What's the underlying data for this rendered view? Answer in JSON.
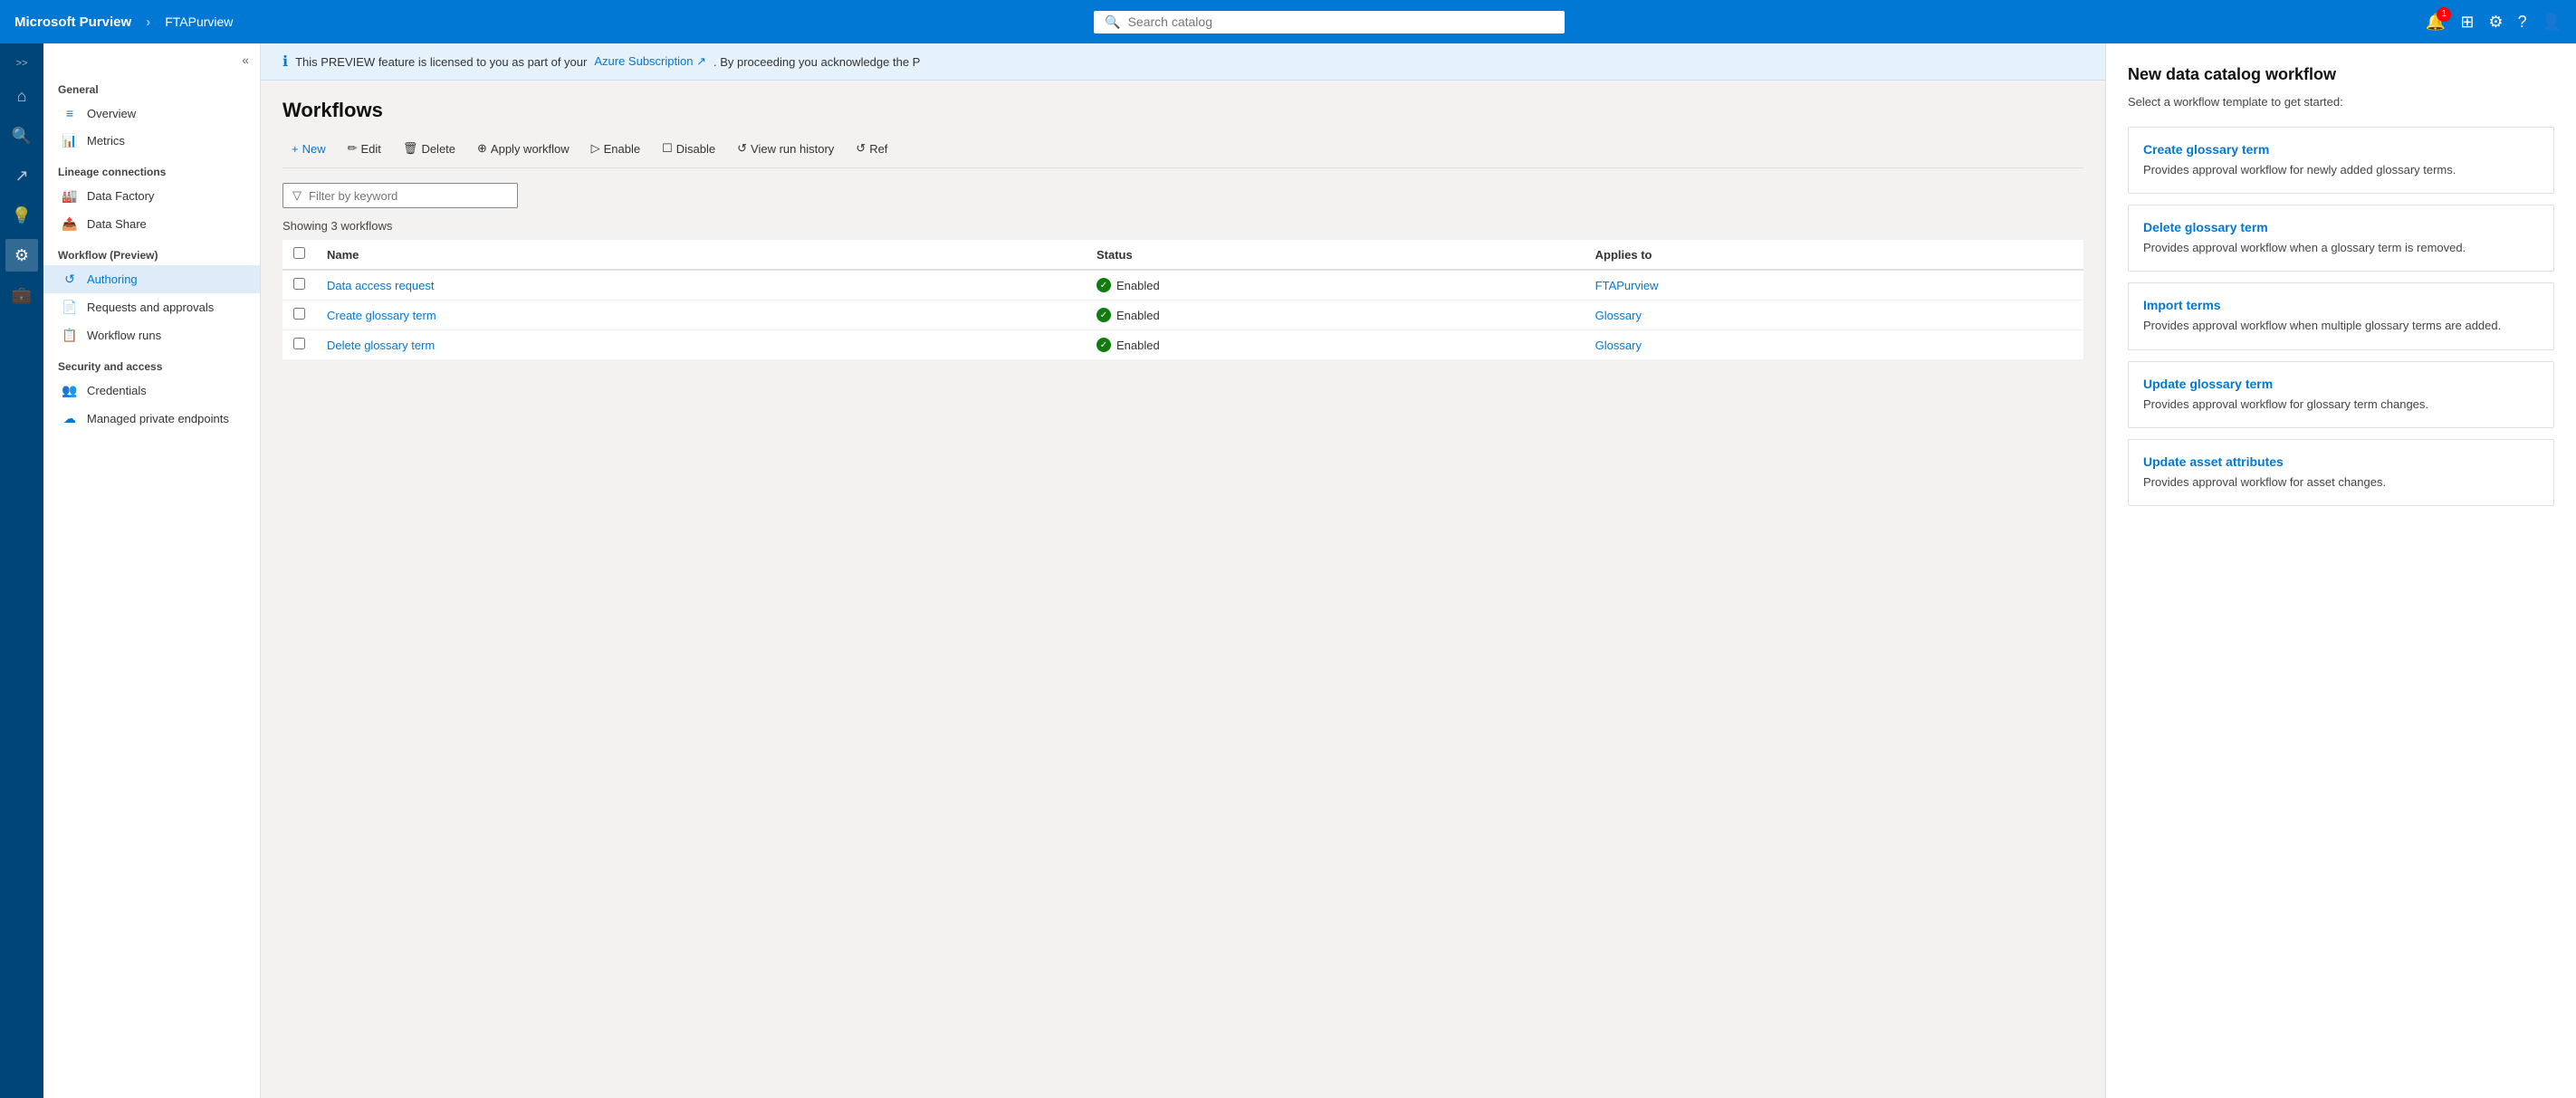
{
  "topNav": {
    "brand": "Microsoft Purview",
    "separator": "›",
    "instance": "FTAPurview",
    "searchPlaceholder": "Search catalog",
    "notificationBadge": "1",
    "icons": {
      "grid": "⊞",
      "bell": "🔔",
      "gear": "⚙",
      "question": "?",
      "user": "👤"
    }
  },
  "leftNav": {
    "collapseBtn": "«",
    "sections": [
      {
        "title": "General",
        "items": [
          {
            "icon": "≡",
            "label": "Overview"
          },
          {
            "icon": "📊",
            "label": "Metrics"
          }
        ]
      },
      {
        "title": "Lineage connections",
        "items": [
          {
            "icon": "🏭",
            "label": "Data Factory"
          },
          {
            "icon": "📤",
            "label": "Data Share"
          }
        ]
      },
      {
        "title": "Workflow (Preview)",
        "items": [
          {
            "icon": "↺",
            "label": "Authoring",
            "active": true
          },
          {
            "icon": "📄",
            "label": "Requests and approvals"
          },
          {
            "icon": "📋",
            "label": "Workflow runs"
          }
        ]
      },
      {
        "title": "Security and access",
        "items": [
          {
            "icon": "👥",
            "label": "Credentials"
          },
          {
            "icon": "☁",
            "label": "Managed private endpoints"
          }
        ]
      }
    ]
  },
  "infoBanner": {
    "text": "This PREVIEW feature is licensed to you as part of your",
    "linkText": "Azure Subscription ↗",
    "textAfter": ". By proceeding you acknowledge the P"
  },
  "page": {
    "title": "Workflows",
    "toolbar": {
      "newLabel": "+ New",
      "editLabel": "✏ Edit",
      "deleteLabel": "🗑 Delete",
      "applyLabel": "⊕ Apply workflow",
      "enableLabel": "▷ Enable",
      "disableLabel": "☐ Disable",
      "viewRunLabel": "↺ View run history",
      "refreshLabel": "↺ Ref"
    },
    "filter": {
      "placeholder": "Filter by keyword",
      "showingCount": "Showing 3 workflows"
    },
    "tableHeaders": [
      "Name",
      "Status",
      "Applies to"
    ],
    "tableRows": [
      {
        "name": "Data access request",
        "status": "Enabled",
        "appliesTo": "FTAPurview"
      },
      {
        "name": "Create glossary term",
        "status": "Enabled",
        "appliesTo": "Glossary"
      },
      {
        "name": "Delete glossary term",
        "status": "Enabled",
        "appliesTo": "Glossary"
      }
    ]
  },
  "rightPanel": {
    "title": "New data catalog workflow",
    "subtitle": "Select a workflow template to get started:",
    "templates": [
      {
        "title": "Create glossary term",
        "description": "Provides approval workflow for newly added glossary terms."
      },
      {
        "title": "Delete glossary term",
        "description": "Provides approval workflow when a glossary term is removed."
      },
      {
        "title": "Import terms",
        "description": "Provides approval workflow when multiple glossary terms are added."
      },
      {
        "title": "Update glossary term",
        "description": "Provides approval workflow for glossary term changes."
      },
      {
        "title": "Update asset attributes",
        "description": "Provides approval workflow for asset changes."
      }
    ]
  }
}
